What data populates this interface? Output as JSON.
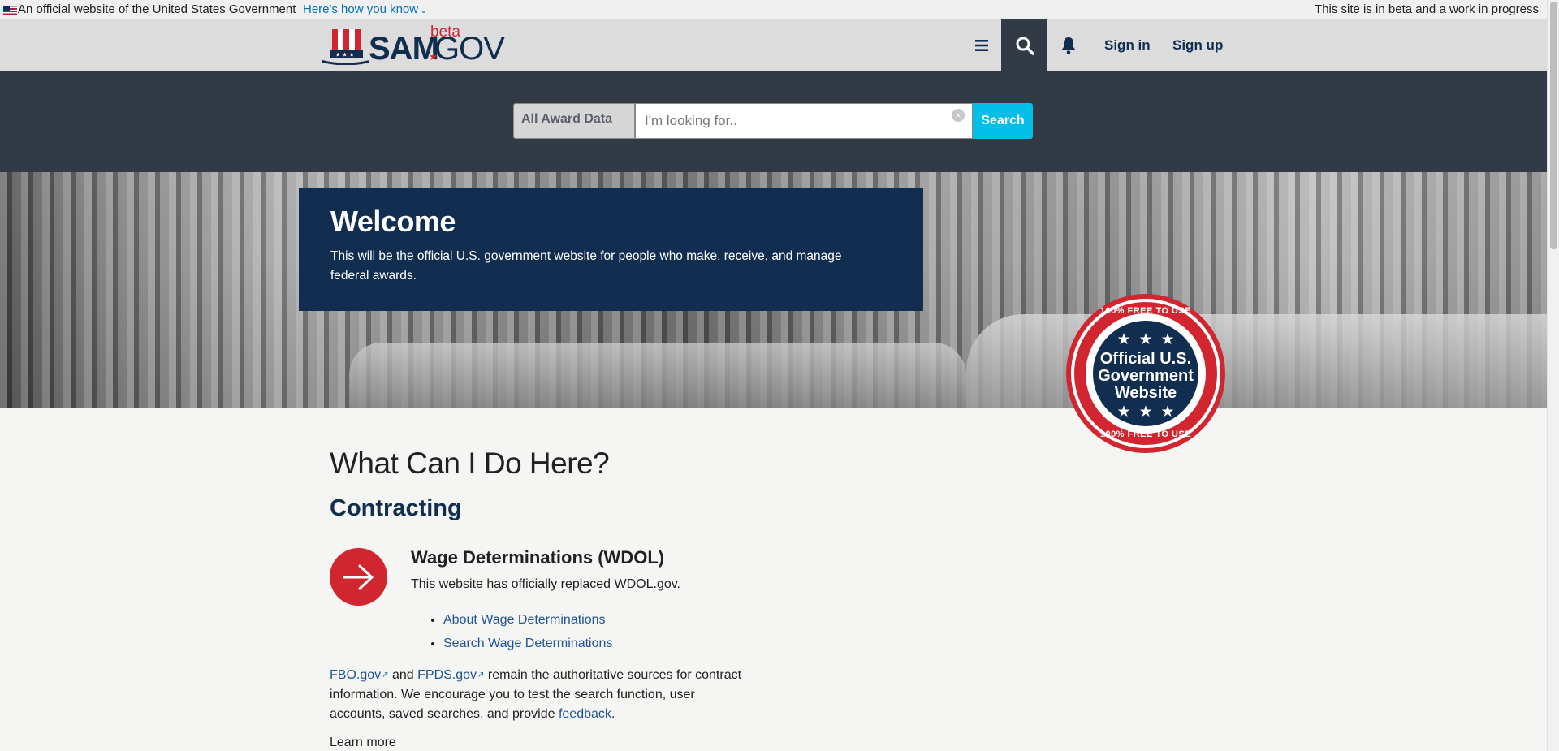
{
  "gov_banner": {
    "official_text": "An official website of the United States Government",
    "how_link": "Here's how you know",
    "beta_notice": "This site is in beta and a work in progress"
  },
  "header": {
    "logo_sam": "SAM",
    "logo_gov": "GOV",
    "logo_beta": "beta",
    "menu_icon": "hamburger-menu-icon",
    "search_icon": "search-icon",
    "notification_icon": "bell-icon",
    "sign_in": "Sign in",
    "sign_up": "Sign up"
  },
  "search": {
    "domain_selected": "All Award Data",
    "placeholder": "I'm looking for..",
    "value": "",
    "clear_icon": "clear-icon",
    "button_label": "Search"
  },
  "hero": {
    "title": "Welcome",
    "description": "This will be the official U.S. government website for people who make, receive, and manage federal awards."
  },
  "seal": {
    "arc_top": "100% FREE TO USE",
    "arc_bottom": "100% FREE TO USE",
    "line1": "Official U.S.",
    "line2": "Government",
    "line3": "Website"
  },
  "main": {
    "page_title": "What Can I Do Here?",
    "section_title": "Contracting",
    "wdol": {
      "title": "Wage Determinations (WDOL)",
      "description": "This website has officially replaced WDOL.gov.",
      "links": [
        "About Wage Determinations",
        "Search Wage Determinations"
      ]
    },
    "paragraph": {
      "fbo_link": "FBO.gov",
      "and": " and ",
      "fpds_link": "FPDS.gov",
      "text": " remain the authoritative sources for contract information. We encourage you to test the search function, user accounts, saved searches, and provide ",
      "feedback_link": "feedback",
      "end": "."
    },
    "learn_more": "Learn more"
  },
  "colors": {
    "navy": "#112e51",
    "red": "#d12630",
    "search_blue": "#02bfe7",
    "dark_band": "#323a45",
    "link": "#205493"
  }
}
